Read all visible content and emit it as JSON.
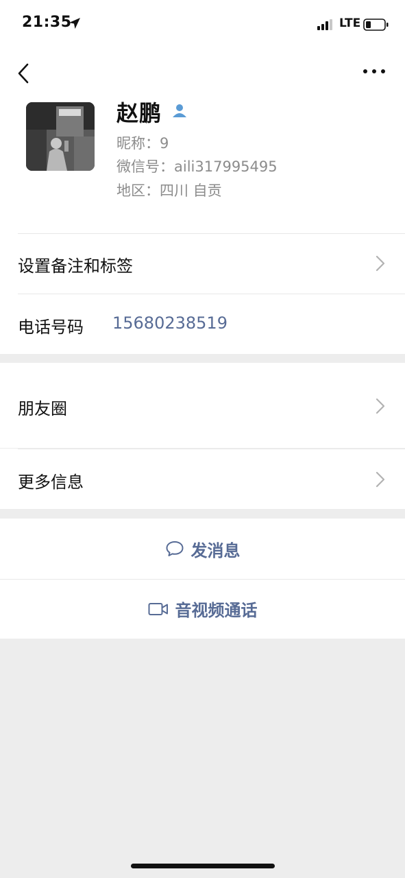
{
  "status_bar": {
    "time": "21:35",
    "network": "LTE",
    "icons": [
      "location-arrow-icon",
      "signal-icon",
      "battery-icon"
    ]
  },
  "nav": {
    "back_icon": "chevron-left-icon",
    "more_icon": "ellipsis-icon"
  },
  "profile": {
    "name": "赵鹏",
    "name_icon": "person-icon",
    "nickname": "昵称：9",
    "wechat_id": "微信号：aili317995495",
    "region": "地区：四川 自贡"
  },
  "settings": {
    "remark_tags_label": "设置备注和标签",
    "phone_label": "电话号码",
    "phone_value": "15680238519"
  },
  "sections": {
    "moments_label": "朋友圈",
    "more_info_label": "更多信息"
  },
  "actions": {
    "send_message_label": "发消息",
    "send_message_icon": "chat-bubble-icon",
    "video_call_label": "音视频通话",
    "video_call_icon": "video-camera-icon"
  },
  "colors": {
    "link_blue": "#576b95",
    "secondary_text": "#8c8c8c",
    "page_background": "#ededed",
    "person_icon_blue": "#5a9bd5"
  }
}
